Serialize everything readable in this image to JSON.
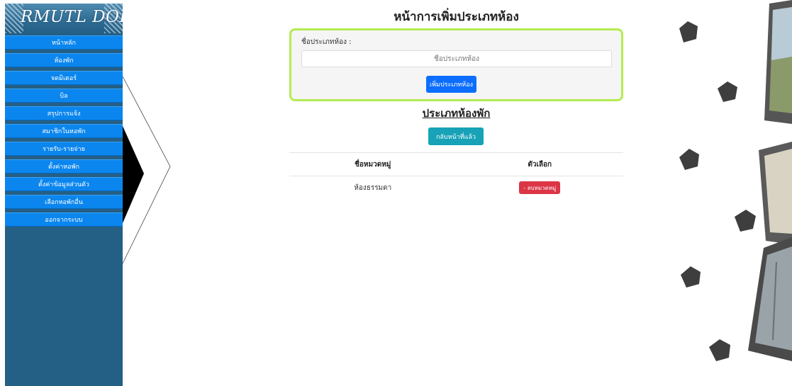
{
  "sidebar": {
    "logo_text": "RMUTL DORM",
    "items": [
      {
        "label": "หน้าหลัก"
      },
      {
        "label": "ห้องพัก"
      },
      {
        "label": "จดมิเตอร์"
      },
      {
        "label": "บิล"
      },
      {
        "label": "สรุปการแจ้ง"
      },
      {
        "label": "สมาชิกในหอพัก"
      },
      {
        "label": "รายรับ-รายจ่าย"
      },
      {
        "label": "ตั้งค่าหอพัก"
      },
      {
        "label": "ตั้งค่าข้อมูลส่วนตัว"
      },
      {
        "label": "เลือกหอพักอื่น"
      },
      {
        "label": "ออกจากระบบ"
      }
    ]
  },
  "main": {
    "page_title": "หน้าการเพิ่มประเภทห้อง",
    "form": {
      "label": "ชื่อประเภทห้อง :",
      "input_placeholder": "ชื่อประเภทห้อง",
      "input_value": "",
      "submit_label": "เพิ่มประเภทห้อง"
    },
    "section_title": "ประเภทห้องพัก",
    "back_label": "กลับหน้าที่แล้ว",
    "table": {
      "headers": [
        "ชื่อหมวดหมู่",
        "ตัวเลือก"
      ],
      "rows": [
        {
          "name": "ห้องธรรมดา",
          "action": "- ลบหมวดหมู่"
        }
      ]
    }
  },
  "colors": {
    "sidebar_bg": "#245f85",
    "menu_item": "#0b86ee",
    "form_border": "#b4ec53",
    "primary_button": "#0d6efd",
    "info_button": "#17a2b8",
    "danger_button": "#dc3545"
  }
}
